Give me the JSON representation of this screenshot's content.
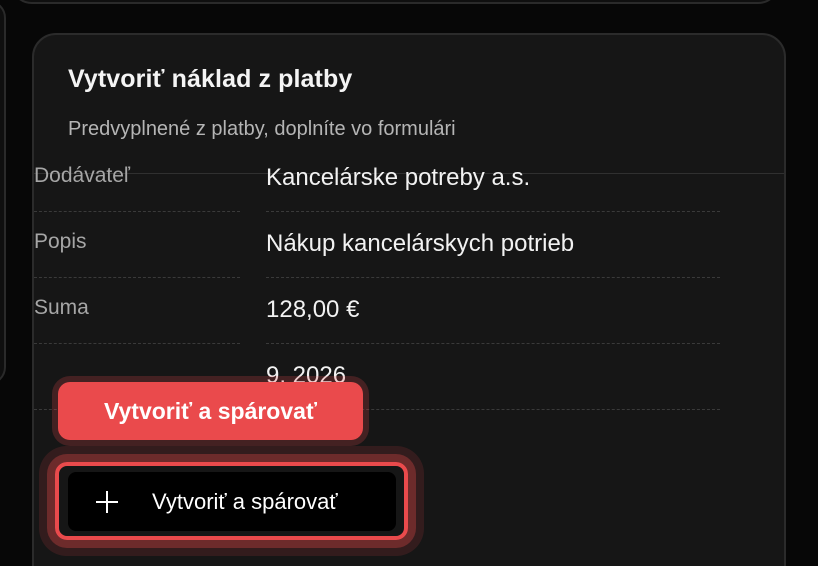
{
  "card": {
    "title": "Vytvoriť náklad z platby",
    "subtitle": "Predvyplnené z platby, doplníte vo formulári"
  },
  "rows": [
    {
      "label": "Dodávateľ",
      "value": "Kancelárske potreby a.s."
    },
    {
      "label": "Popis",
      "value": "Nákup kancelárskych potrieb"
    },
    {
      "label": "Suma",
      "value": "128,00 €"
    },
    {
      "label": "",
      "value": "9. 2026"
    }
  ],
  "tooltip": {
    "label": "Vytvoriť a spárovať"
  },
  "action": {
    "label": "Vytvoriť a spárovať",
    "icon": "plus-icon",
    "accent_color": "#ea4a4c"
  }
}
